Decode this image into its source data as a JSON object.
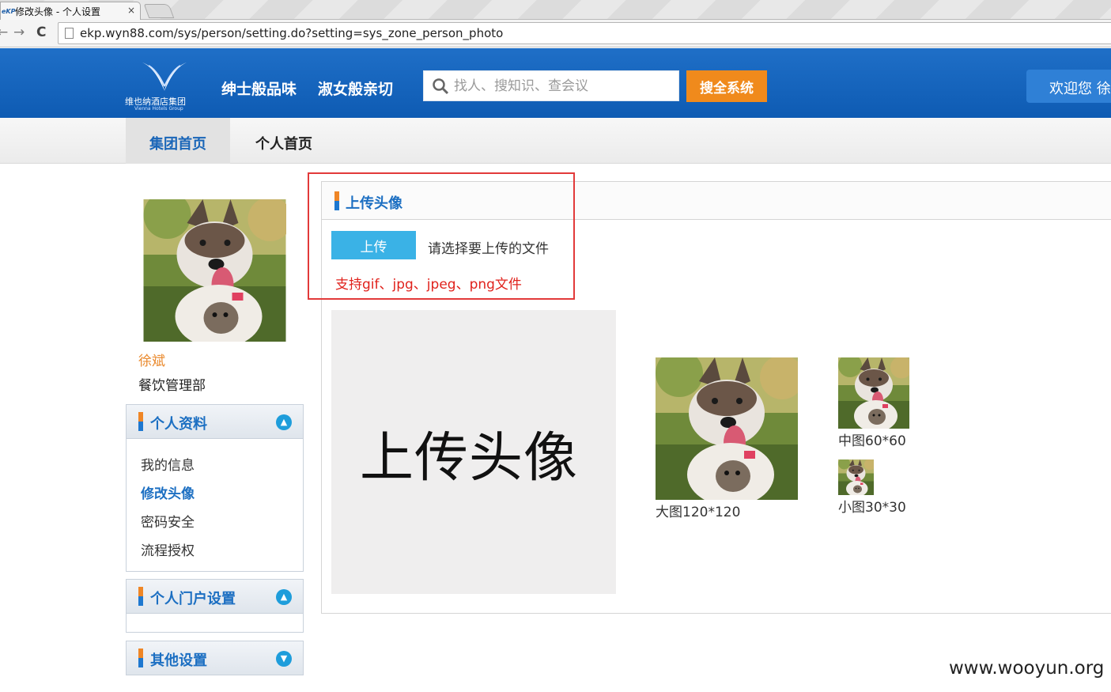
{
  "browser": {
    "tab_favicon_text": "eKP",
    "tab_title": "修改头像 - 个人设置",
    "tab_close": "×",
    "back": "←",
    "forward": "→",
    "reload": "C",
    "url": "ekp.wyn88.com/sys/person/setting.do?setting=sys_zone_person_photo"
  },
  "header": {
    "logo_name": "维也纳酒店集团",
    "logo_sub": "Vienna Hotels Group",
    "slogan1": "绅士般品味",
    "slogan2": "淑女般亲切",
    "search_placeholder": "找人、搜知识、查会议",
    "search_button": "搜全系统",
    "welcome": "欢迎您 徐"
  },
  "nav": {
    "tab1": "集团首页",
    "tab2": "个人首页"
  },
  "profile": {
    "name": "徐斌",
    "dept": "餐饮管理部"
  },
  "sidebar": {
    "panel1": {
      "title": "个人资料",
      "items": [
        "我的信息",
        "修改头像",
        "密码安全",
        "流程授权"
      ],
      "active": "修改头像"
    },
    "panel2": {
      "title": "个人门户设置"
    },
    "panel3": {
      "title": "其他设置"
    }
  },
  "main": {
    "title": "上传头像",
    "upload_button": "上传",
    "file_hint": "请选择要上传的文件",
    "format_hint": "支持gif、jpg、jpeg、png文件",
    "preview_text": "上传头像",
    "large_label": "大图120*120",
    "medium_label": "中图60*60",
    "small_label": "小图30*30"
  },
  "watermark": "www.wooyun.org",
  "colors": {
    "header_blue": "#1565c0",
    "accent_orange": "#f08a1c",
    "link_blue": "#1c6fc2",
    "highlight_red": "#e23a3a",
    "upload_blue": "#3ab2e6"
  }
}
